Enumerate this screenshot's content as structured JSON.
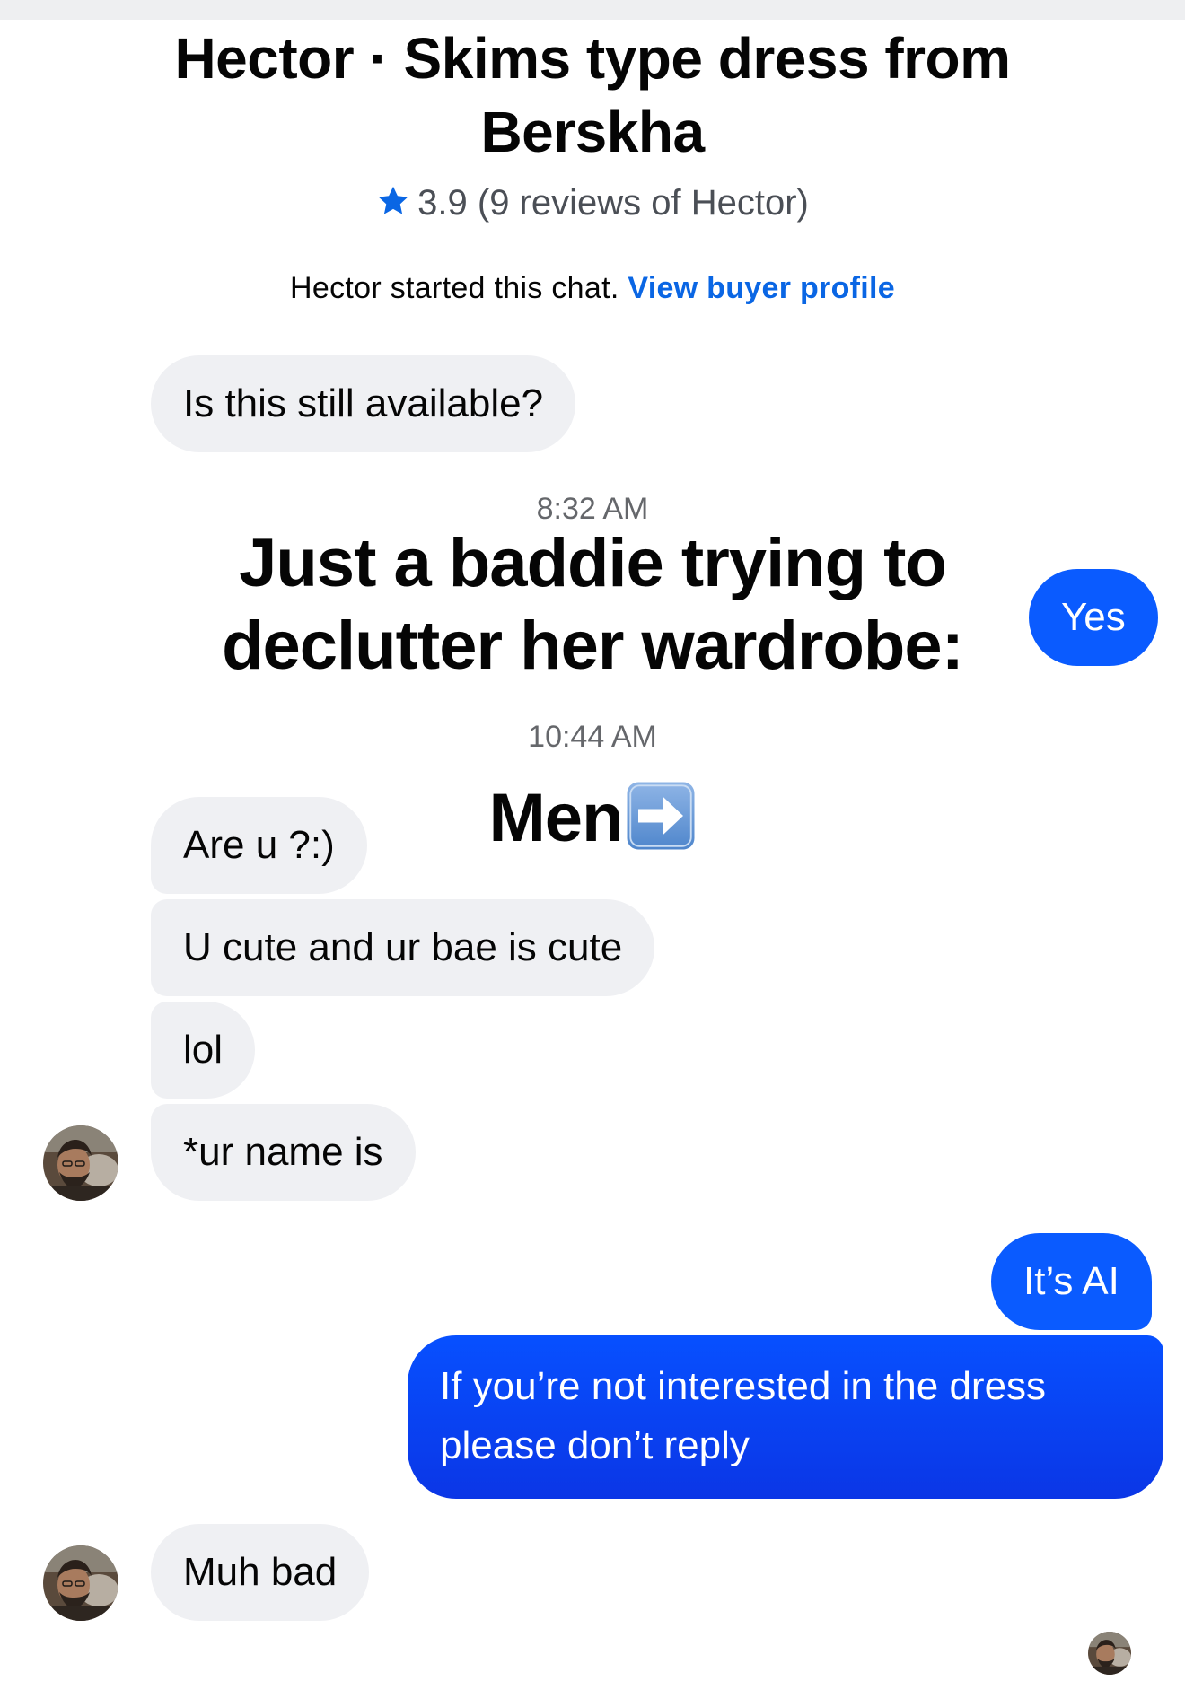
{
  "header": {
    "title": "Hector · Skims type dress from Berskha",
    "rating": "3.9",
    "reviews": "(9 reviews of Hector)",
    "star_icon": "star-icon",
    "accent": "#0a66e4"
  },
  "notice": {
    "text": "Hector started this chat.",
    "link_label": "View buyer profile"
  },
  "messages": {
    "m1": "Is this still available?",
    "ts1": "8:32 AM",
    "caption1": "Just a baddie trying to declutter her wardrobe:",
    "m2": "Yes",
    "ts2": "10:44 AM",
    "caption2": "Men",
    "caption2_icon": "right-arrow-emoji-icon",
    "m3": "Are u ?:)",
    "m4": "U cute and ur bae is cute",
    "m5": "lol",
    "m6": "*ur name is",
    "m7": "It’s AI",
    "m8": "If you’re not interested in the dress please don’t reply",
    "m9": "Muh bad"
  },
  "colors": {
    "incoming_bubble": "#eff0f3",
    "outgoing_bubble": "#0a5bff",
    "link": "#0a66e4"
  }
}
